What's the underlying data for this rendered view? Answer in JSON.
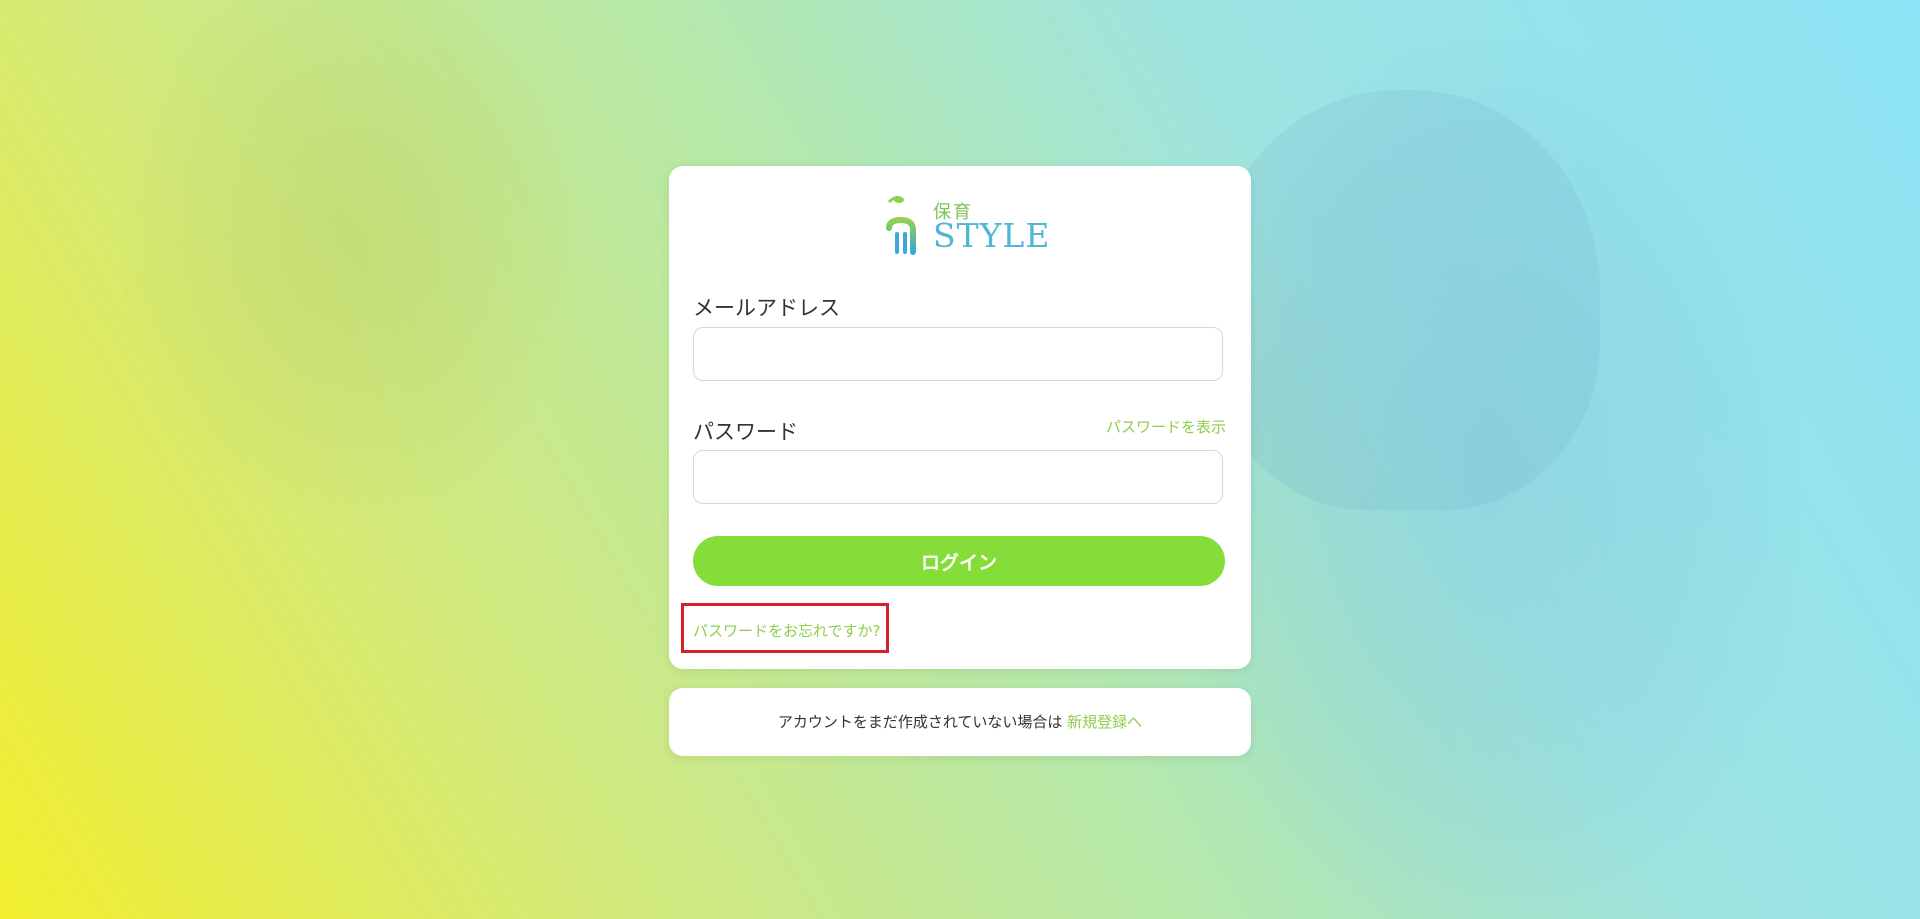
{
  "brand": {
    "logo_jp": "保育",
    "logo_name": "STYLE"
  },
  "form": {
    "email_label": "メールアドレス",
    "email_value": "",
    "email_placeholder": "",
    "password_label": "パスワード",
    "password_value": "",
    "password_placeholder": "",
    "show_password": "パスワードを表示",
    "login_button": "ログイン",
    "forgot_password": "パスワードをお忘れですか?"
  },
  "signup": {
    "prompt": "アカウントをまだ作成されていない場合は",
    "link": "新規登録へ"
  },
  "colors": {
    "accent_green": "#86dd3a",
    "link_green": "#8fcd4a",
    "highlight_red": "#d2232a",
    "logo_blue": "#4fb6d8"
  }
}
